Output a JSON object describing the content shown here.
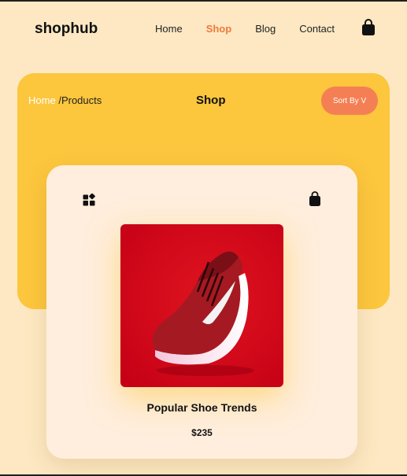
{
  "nav": {
    "brand": "shophub",
    "links": [
      "Home",
      "Shop",
      "Blog",
      "Contact"
    ],
    "active_link": "Shop",
    "cart_icon": "shopping-bag-icon"
  },
  "hero": {
    "breadcrumb": {
      "home": "Home",
      "separator": "/",
      "current": "Products"
    },
    "title": "Shop",
    "sort_label": "Sort By V"
  },
  "card": {
    "layout_icon": "grid-shapes-icon",
    "cart_icon": "shopping-bag-icon",
    "product_name": "Popular Shoe Trends",
    "price": "$235"
  },
  "colors": {
    "page_background": "#fde8c3",
    "hero_background": "#fcc63d",
    "accent": "#f07a3c",
    "sort_button": "#f57f54",
    "card_background": "#ffeedd"
  }
}
